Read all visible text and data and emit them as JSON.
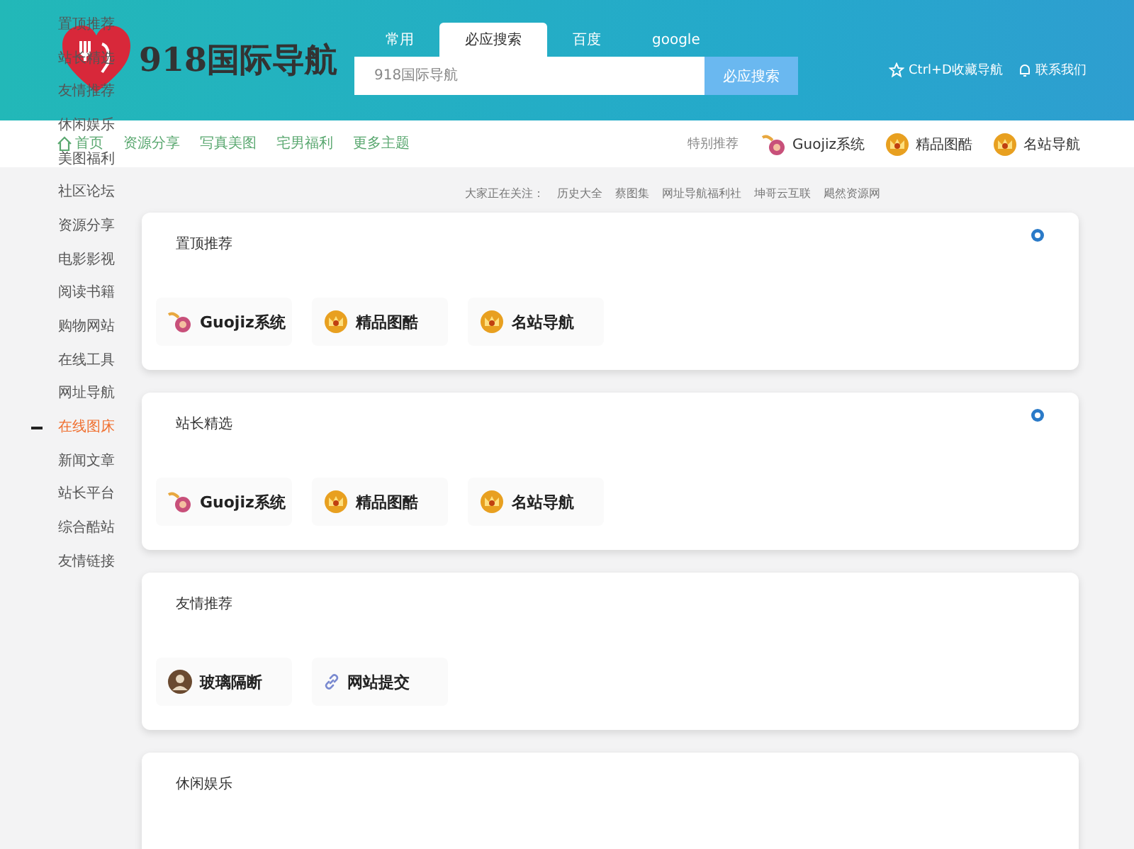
{
  "sidebar": {
    "items": [
      {
        "label": "置顶推荐",
        "selected": false
      },
      {
        "label": "站长精选",
        "selected": false
      },
      {
        "label": "友情推荐",
        "selected": false
      },
      {
        "label": "休闲娱乐",
        "selected": false
      },
      {
        "label": "美图福利",
        "selected": false
      },
      {
        "label": "社区论坛",
        "selected": false
      },
      {
        "label": "资源分享",
        "selected": false
      },
      {
        "label": "电影影视",
        "selected": false
      },
      {
        "label": "阅读书籍",
        "selected": false
      },
      {
        "label": "购物网站",
        "selected": false
      },
      {
        "label": "在线工具",
        "selected": false
      },
      {
        "label": "网址导航",
        "selected": false
      },
      {
        "label": "在线图床",
        "selected": true
      },
      {
        "label": "新闻文章",
        "selected": false
      },
      {
        "label": "站长平台",
        "selected": false
      },
      {
        "label": "综合酷站",
        "selected": false
      },
      {
        "label": "友情链接",
        "selected": false
      }
    ]
  },
  "header": {
    "logo_text": "918国际导航",
    "search_tabs": [
      {
        "label": "常用",
        "selected": false
      },
      {
        "label": "必应搜索",
        "selected": true
      },
      {
        "label": "百度",
        "selected": false
      },
      {
        "label": "google",
        "selected": false
      }
    ],
    "search": {
      "placeholder": "918国际导航"
    },
    "search_button": "必应搜索",
    "links": [
      {
        "label": "Ctrl+D收藏导航",
        "kind": "star"
      },
      {
        "label": "联系我们",
        "kind": "bell"
      }
    ]
  },
  "nav": {
    "items": [
      {
        "label": "首页",
        "kind": "home"
      },
      {
        "label": "资源分享"
      },
      {
        "label": "写真美图"
      },
      {
        "label": "宅男福利"
      },
      {
        "label": "更多主题"
      }
    ],
    "featured_label": "特别推荐",
    "featured": [
      {
        "label": "Guojiz系统",
        "kind": "swirl"
      },
      {
        "label": "精品图酷",
        "kind": "crown"
      },
      {
        "label": "名站导航",
        "kind": "crown"
      }
    ]
  },
  "hot": {
    "label": "大家正在关注：",
    "links": [
      "历史大全",
      "蔡图集",
      "网址导航福利社",
      "坤哥云互联",
      "飓然资源网"
    ]
  },
  "sections": [
    {
      "title": "置顶推荐",
      "badge": true,
      "sites": [
        {
          "label": "Guojiz系统",
          "kind": "swirl"
        },
        {
          "label": "精品图酷",
          "kind": "crown"
        },
        {
          "label": "名站导航",
          "kind": "crown"
        }
      ]
    },
    {
      "title": "站长精选",
      "badge": true,
      "sites": [
        {
          "label": "Guojiz系统",
          "kind": "swirl"
        },
        {
          "label": "精品图酷",
          "kind": "crown"
        },
        {
          "label": "名站导航",
          "kind": "crown"
        }
      ]
    },
    {
      "title": "友情推荐",
      "badge": false,
      "sites": [
        {
          "label": "玻璃隔断",
          "kind": "avatar"
        },
        {
          "label": "网站提交",
          "kind": "link"
        }
      ]
    },
    {
      "title": "休闲娱乐",
      "badge": false
    }
  ]
}
